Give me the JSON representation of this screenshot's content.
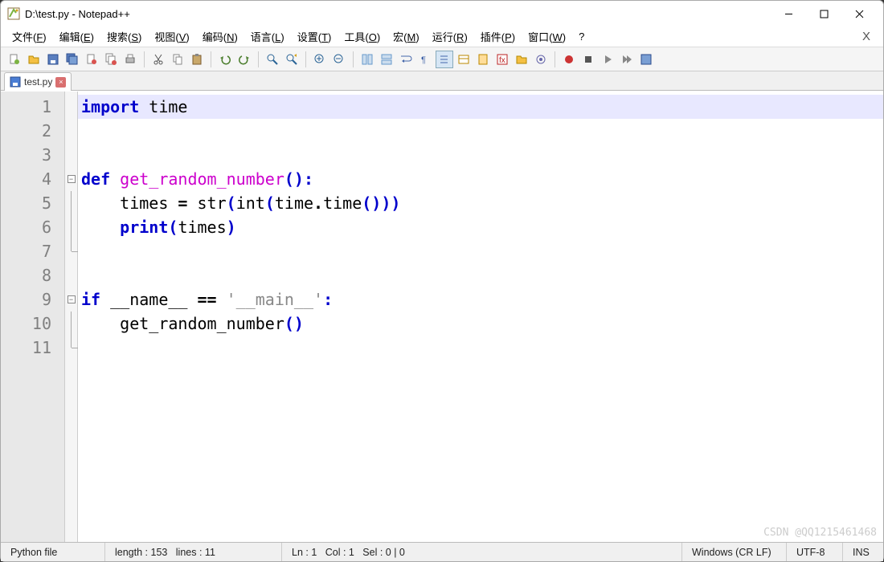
{
  "window": {
    "title": "D:\\test.py - Notepad++"
  },
  "menu": {
    "items": [
      {
        "label": "文件",
        "mn": "F"
      },
      {
        "label": "编辑",
        "mn": "E"
      },
      {
        "label": "搜索",
        "mn": "S"
      },
      {
        "label": "视图",
        "mn": "V"
      },
      {
        "label": "编码",
        "mn": "N"
      },
      {
        "label": "语言",
        "mn": "L"
      },
      {
        "label": "设置",
        "mn": "T"
      },
      {
        "label": "工具",
        "mn": "O"
      },
      {
        "label": "宏",
        "mn": "M"
      },
      {
        "label": "运行",
        "mn": "R"
      },
      {
        "label": "插件",
        "mn": "P"
      },
      {
        "label": "窗口",
        "mn": "W"
      },
      {
        "label": "?",
        "mn": ""
      }
    ],
    "close_x": "X"
  },
  "tab": {
    "filename": "test.py",
    "close": "×"
  },
  "code": {
    "lines": [
      {
        "n": "1",
        "tokens": [
          {
            "t": "import ",
            "c": "kw"
          },
          {
            "t": "time",
            "c": ""
          }
        ]
      },
      {
        "n": "2",
        "tokens": []
      },
      {
        "n": "3",
        "tokens": []
      },
      {
        "n": "4",
        "tokens": [
          {
            "t": "def ",
            "c": "kw"
          },
          {
            "t": "get_random_number",
            "c": "fn"
          },
          {
            "t": "():",
            "c": "pn"
          }
        ]
      },
      {
        "n": "5",
        "tokens": [
          {
            "t": "    times ",
            "c": ""
          },
          {
            "t": "=",
            "c": "op"
          },
          {
            "t": " str",
            "c": ""
          },
          {
            "t": "(",
            "c": "pn"
          },
          {
            "t": "int",
            "c": ""
          },
          {
            "t": "(",
            "c": "pn"
          },
          {
            "t": "time",
            "c": ""
          },
          {
            "t": ".",
            "c": "op"
          },
          {
            "t": "time",
            "c": ""
          },
          {
            "t": "()))",
            "c": "pn"
          }
        ]
      },
      {
        "n": "6",
        "tokens": [
          {
            "t": "    ",
            "c": ""
          },
          {
            "t": "print",
            "c": "kw"
          },
          {
            "t": "(",
            "c": "pn"
          },
          {
            "t": "times",
            "c": ""
          },
          {
            "t": ")",
            "c": "pn"
          }
        ]
      },
      {
        "n": "7",
        "tokens": []
      },
      {
        "n": "8",
        "tokens": []
      },
      {
        "n": "9",
        "tokens": [
          {
            "t": "if ",
            "c": "kw"
          },
          {
            "t": "__name__ ",
            "c": ""
          },
          {
            "t": "==",
            "c": "op"
          },
          {
            "t": " ",
            "c": ""
          },
          {
            "t": "'__main__'",
            "c": "str"
          },
          {
            "t": ":",
            "c": "pn"
          }
        ]
      },
      {
        "n": "10",
        "tokens": [
          {
            "t": "    get_random_number",
            "c": ""
          },
          {
            "t": "()",
            "c": "pn"
          }
        ]
      },
      {
        "n": "11",
        "tokens": []
      }
    ],
    "fold_marks": {
      "4": "box",
      "5": "line",
      "6": "line",
      "7": "end",
      "9": "box",
      "10": "line",
      "11": "end"
    }
  },
  "status": {
    "lang": "Python file",
    "length_label": "length :",
    "length_val": "153",
    "lines_label": "lines :",
    "lines_val": "11",
    "ln_label": "Ln :",
    "ln_val": "1",
    "col_label": "Col :",
    "col_val": "1",
    "sel_label": "Sel :",
    "sel_val": "0 | 0",
    "eol": "Windows (CR LF)",
    "encoding": "UTF-8",
    "mode": "INS"
  },
  "watermark": "CSDN @QQ1215461468"
}
